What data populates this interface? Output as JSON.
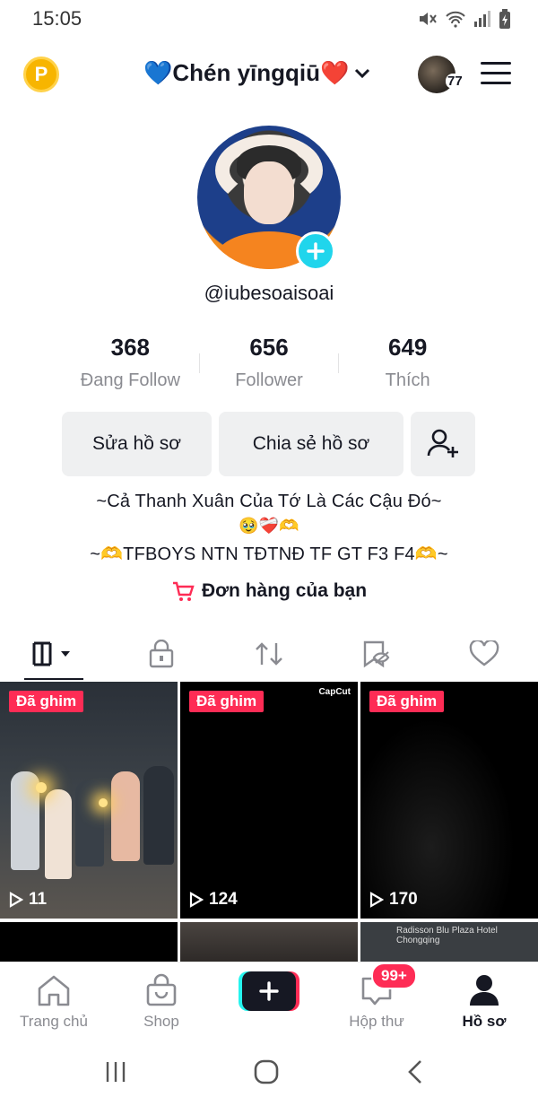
{
  "status_bar": {
    "time": "15:05"
  },
  "header": {
    "coin_letter": "P",
    "username": "💙Chén yīngqiū❤️",
    "story_count": "77"
  },
  "profile": {
    "handle": "@iubesoaisoai",
    "stats": [
      {
        "value": "368",
        "label": "Đang Follow"
      },
      {
        "value": "656",
        "label": "Follower"
      },
      {
        "value": "649",
        "label": "Thích"
      }
    ],
    "edit_button": "Sửa hồ sơ",
    "share_button": "Chia sẻ hồ sơ",
    "bio_line1": "~Cả Thanh Xuân Của Tớ Là Các Cậu Đó~",
    "bio_line2": "🥹❤️‍🩹🫶",
    "bio_line3": "~🫶TFBOYS NTN TĐTNĐ TF GT F3 F4🫶~",
    "orders_label": "Đơn hàng của bạn"
  },
  "tabs": [
    {
      "name": "videos",
      "icon": "grid-icon",
      "active": true
    },
    {
      "name": "private",
      "icon": "lock-icon",
      "active": false
    },
    {
      "name": "reposts",
      "icon": "repost-icon",
      "active": false
    },
    {
      "name": "favorites",
      "icon": "bookmark-eye-icon",
      "active": false
    },
    {
      "name": "liked",
      "icon": "heart-icon",
      "active": false
    }
  ],
  "videos": [
    {
      "pinned_label": "Đã ghim",
      "views": "11"
    },
    {
      "pinned_label": "Đã ghim",
      "views": "124",
      "watermark": "CapCut"
    },
    {
      "pinned_label": "Đã ghim",
      "views": "170"
    }
  ],
  "map_label": "Radisson Blu Plaza Hotel Chongqing",
  "bottom_nav": {
    "home": "Trang chủ",
    "shop": "Shop",
    "inbox": "Hộp thư",
    "inbox_badge": "99+",
    "profile": "Hồ sơ"
  },
  "colors": {
    "accent_red": "#fe2c55",
    "accent_cyan": "#25f4ee",
    "text": "#161823",
    "muted": "#8a8b91"
  }
}
